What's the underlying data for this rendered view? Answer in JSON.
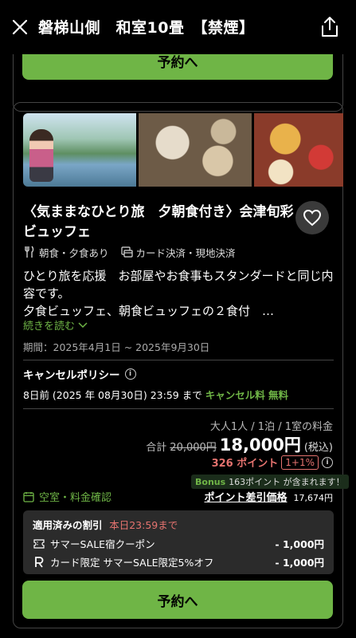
{
  "header": {
    "title": "磐梯山側　和室10畳　【禁煙】"
  },
  "reserve_label": "予約へ",
  "plan": {
    "title": "〈気ままなひとり旅　夕朝食付き〉会津旬彩ビュッフェ",
    "meal": "朝食・夕食あり",
    "payment": "カード決済・現地決済",
    "description_line1": "ひとり旅を応援　お部屋やお食事もスタンダードと同じ内容です。",
    "description_line2": "夕食ビュッフェ、朝食ビュッフェの２食付　…",
    "read_more": "続きを読む",
    "period": "期間：2025年4月1日 ~ 2025年9月30日"
  },
  "cancel": {
    "title": "キャンセルポリシー",
    "text": "8日前 (2025 年 08月30日) 23:59 まで ",
    "free": "キャンセル料 無料"
  },
  "pricing": {
    "guests": "大人1人 / 1泊 / 1室の料金",
    "total_label": "合計",
    "original": "20,000円",
    "price": "18,000円",
    "tax": "(税込)",
    "points": "326 ポイント",
    "rate": "1+1%",
    "bonus_label": "Bonus",
    "bonus_text": "163ポイント が含まれます！",
    "availability": "空室・料金確認",
    "diff_label": "ポイント差引価格",
    "diff_value": "17,674円"
  },
  "discounts": {
    "head": "適用済みの割引",
    "deadline": "本日23:59まで",
    "items": [
      {
        "label": "サマーSALE宿クーポン",
        "amount": "- 1,000円"
      },
      {
        "label": "カード限定 サマーSALE限定5%オフ",
        "amount": "- 1,000円"
      }
    ]
  },
  "colors": {
    "accent_green": "#6fb546",
    "accent_red": "#e5736f",
    "background": "#000000"
  }
}
